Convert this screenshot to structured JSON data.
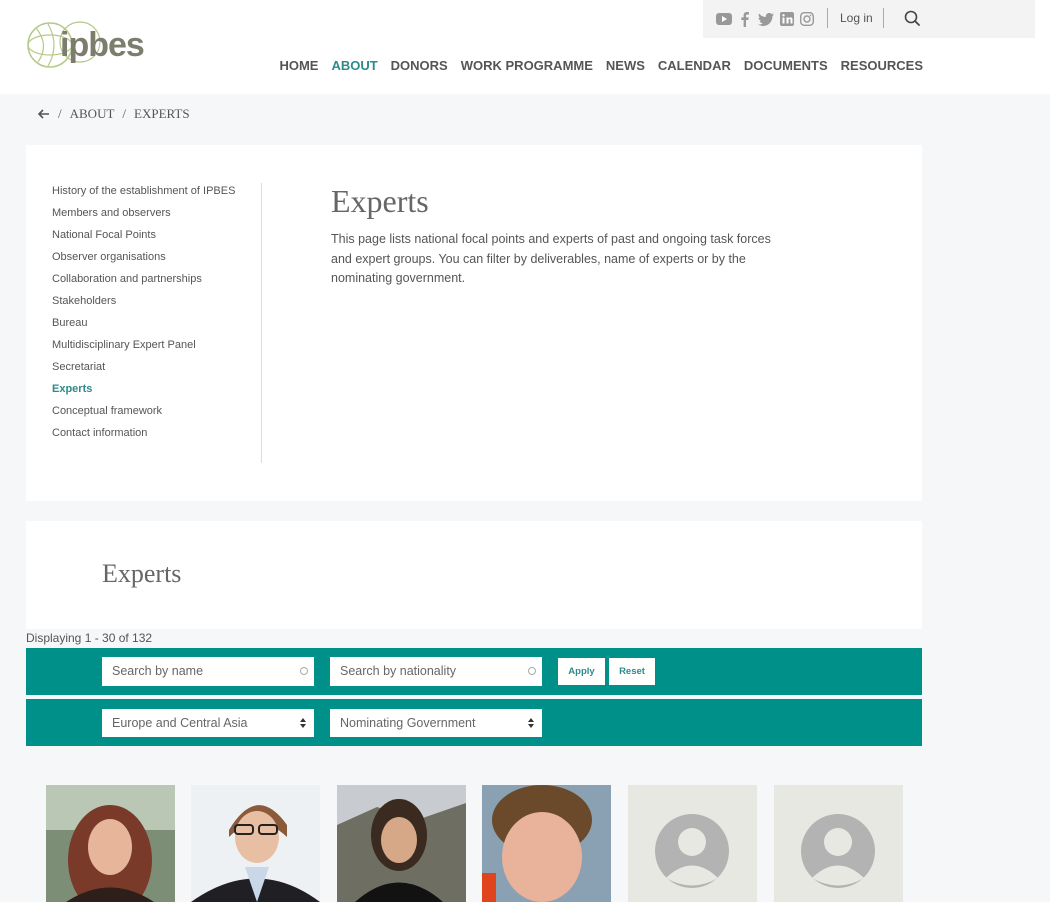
{
  "header": {
    "logo_text": "ipbes",
    "login_label": "Log in",
    "nav": [
      "HOME",
      "ABOUT",
      "DONORS",
      "WORK PROGRAMME",
      "NEWS",
      "CALENDAR",
      "DOCUMENTS",
      "RESOURCES"
    ],
    "active_nav": "ABOUT"
  },
  "breadcrumb": {
    "sep": "/",
    "items": [
      "ABOUT",
      "EXPERTS"
    ]
  },
  "sidebar": {
    "items": [
      "History of the establishment of IPBES",
      "Members and observers",
      "National Focal Points",
      "Observer organisations",
      "Collaboration and partnerships",
      "Stakeholders",
      "Bureau",
      "Multidisciplinary Expert Panel",
      "Secretariat",
      "Experts",
      "Conceptual framework",
      "Contact information"
    ],
    "active": "Experts"
  },
  "intro": {
    "title": "Experts",
    "text": "This page lists national focal points and experts of past and ongoing task forces and expert groups. You can filter by deliverables, name of experts or by the nominating government."
  },
  "listing": {
    "title": "Experts",
    "count": "Displaying 1 - 30 of 132",
    "search_name_placeholder": "Search by name",
    "search_nationality_placeholder": "Search by nationality",
    "apply_label": "Apply",
    "reset_label": "Reset",
    "region_selected": "Europe and Central Asia",
    "role_selected": "Nominating Government"
  },
  "colors": {
    "accent": "#2f8a8a",
    "filterbar": "#00908a"
  },
  "photos": [
    "photo",
    "photo",
    "photo",
    "photo",
    "placeholder",
    "placeholder"
  ]
}
